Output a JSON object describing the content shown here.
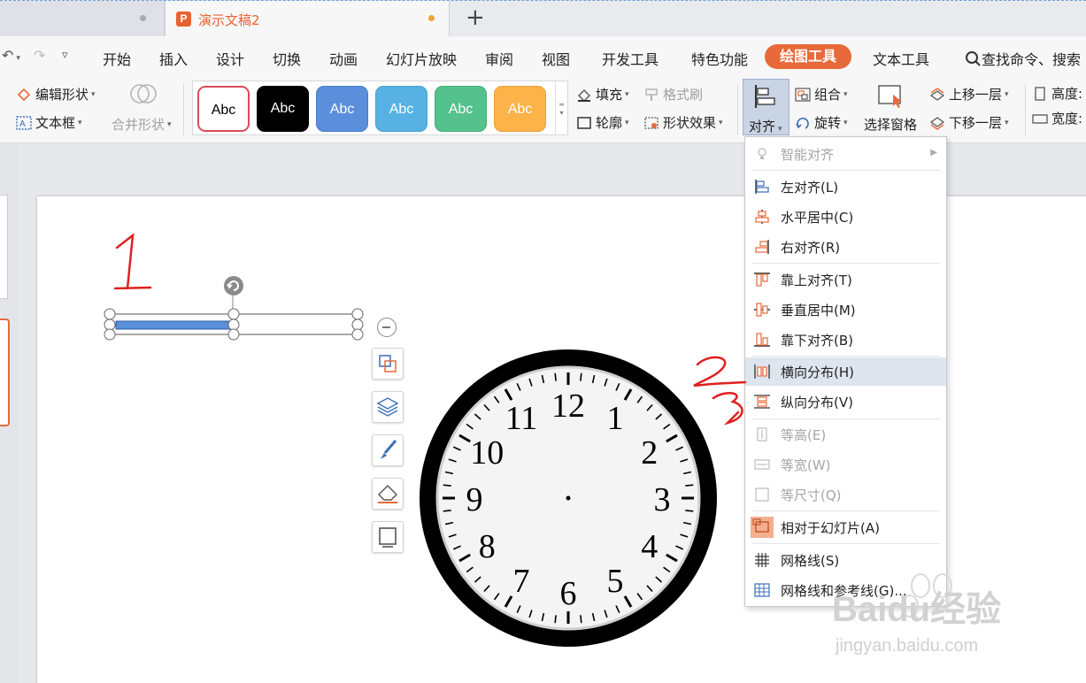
{
  "tabs": {
    "active_icon": "P",
    "active_title": "演示文稿2",
    "new_tab": "+"
  },
  "menu": {
    "items": [
      "开始",
      "插入",
      "设计",
      "切换",
      "动画",
      "幻灯片放映",
      "审阅",
      "视图",
      "开发工具",
      "特色功能",
      "绘图工具",
      "文本工具"
    ],
    "active": "绘图工具",
    "search": "查找命令、搜索"
  },
  "ribbon": {
    "edit_shape": "编辑形状",
    "text_box": "文本框",
    "merge_shape": "合并形状",
    "swatch_text": "Abc",
    "fill": "填充",
    "format_painter": "格式刷",
    "outline": "轮廓",
    "shape_effect": "形状效果",
    "align": "对齐",
    "group": "组合",
    "rotate": "旋转",
    "selection_pane": "选择窗格",
    "bring_forward": "上移一层",
    "send_backward": "下移一层",
    "height": "高度:",
    "width": "宽度:"
  },
  "swatch_colors": [
    "#ffffff",
    "#000000",
    "#5b8fdc",
    "#57b2e3",
    "#55c18d",
    "#fbb34a"
  ],
  "align_menu": {
    "smart": "智能对齐",
    "left": "左对齐(L)",
    "center_h": "水平居中(C)",
    "right": "右对齐(R)",
    "top": "靠上对齐(T)",
    "middle_v": "垂直居中(M)",
    "bottom": "靠下对齐(B)",
    "distribute_h": "横向分布(H)",
    "distribute_v": "纵向分布(V)",
    "same_height": "等高(E)",
    "same_width": "等宽(W)",
    "same_size": "等尺寸(Q)",
    "relative_slide": "相对于幻灯片(A)",
    "gridlines": "网格线(S)",
    "grid_guides": "网格线和参考线(G)..."
  },
  "annotations": {
    "one": "1",
    "two": "2",
    "three": "3"
  },
  "clock_numbers": [
    "12",
    "1",
    "2",
    "3",
    "4",
    "5",
    "6",
    "7",
    "8",
    "9",
    "10",
    "11"
  ],
  "watermark": {
    "brand": "Baidu经验",
    "url": "jingyan.baidu.com"
  },
  "colors": {
    "accent": "#e8693a",
    "selection_fill": "#5b8fdc",
    "ink": "#e02020"
  },
  "icons": [
    "undo-icon",
    "redo-icon",
    "search-icon",
    "rotate-handle-icon",
    "minus-icon",
    "crop-icon",
    "layers-icon",
    "brush-icon",
    "eraser-icon",
    "frame-icon"
  ]
}
